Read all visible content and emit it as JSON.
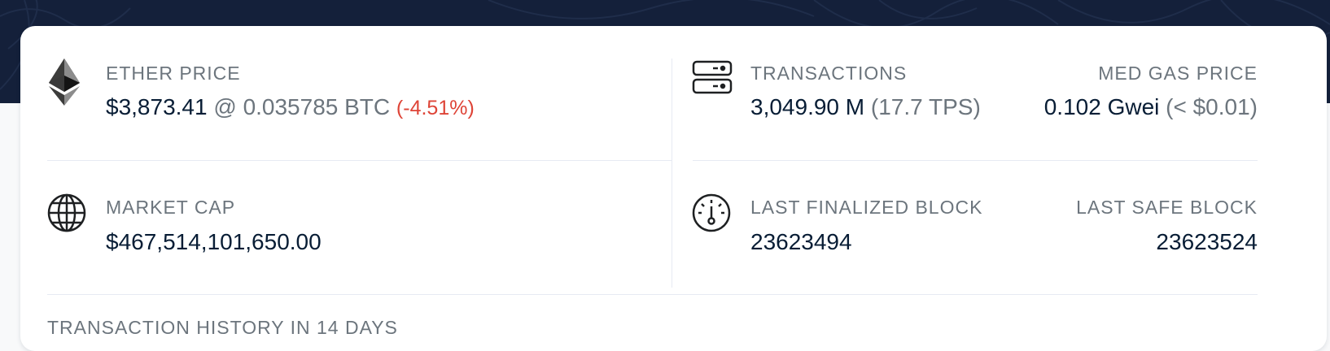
{
  "ether_price": {
    "label": "ETHER PRICE",
    "usd": "$3,873.41",
    "btc": "@ 0.035785 BTC",
    "change": "(-4.51%)"
  },
  "market_cap": {
    "label": "MARKET CAP",
    "value": "$467,514,101,650.00"
  },
  "transactions": {
    "label": "TRANSACTIONS",
    "value": "3,049.90 M",
    "tps": "(17.7 TPS)"
  },
  "med_gas_price": {
    "label": "MED GAS PRICE",
    "value": "0.102 Gwei",
    "usd": "(< $0.01)"
  },
  "last_finalized_block": {
    "label": "LAST FINALIZED BLOCK",
    "value": "23623494"
  },
  "last_safe_block": {
    "label": "LAST SAFE BLOCK",
    "value": "23623524"
  },
  "history": {
    "label": "TRANSACTION HISTORY IN 14 DAYS"
  },
  "colors": {
    "hero_bg": "#14203a",
    "text_dark": "#081d35",
    "text_muted": "#6c757d",
    "negative": "#de4437"
  },
  "icons": [
    "ethereum-icon",
    "globe-icon",
    "server-icon",
    "gauge-icon"
  ]
}
